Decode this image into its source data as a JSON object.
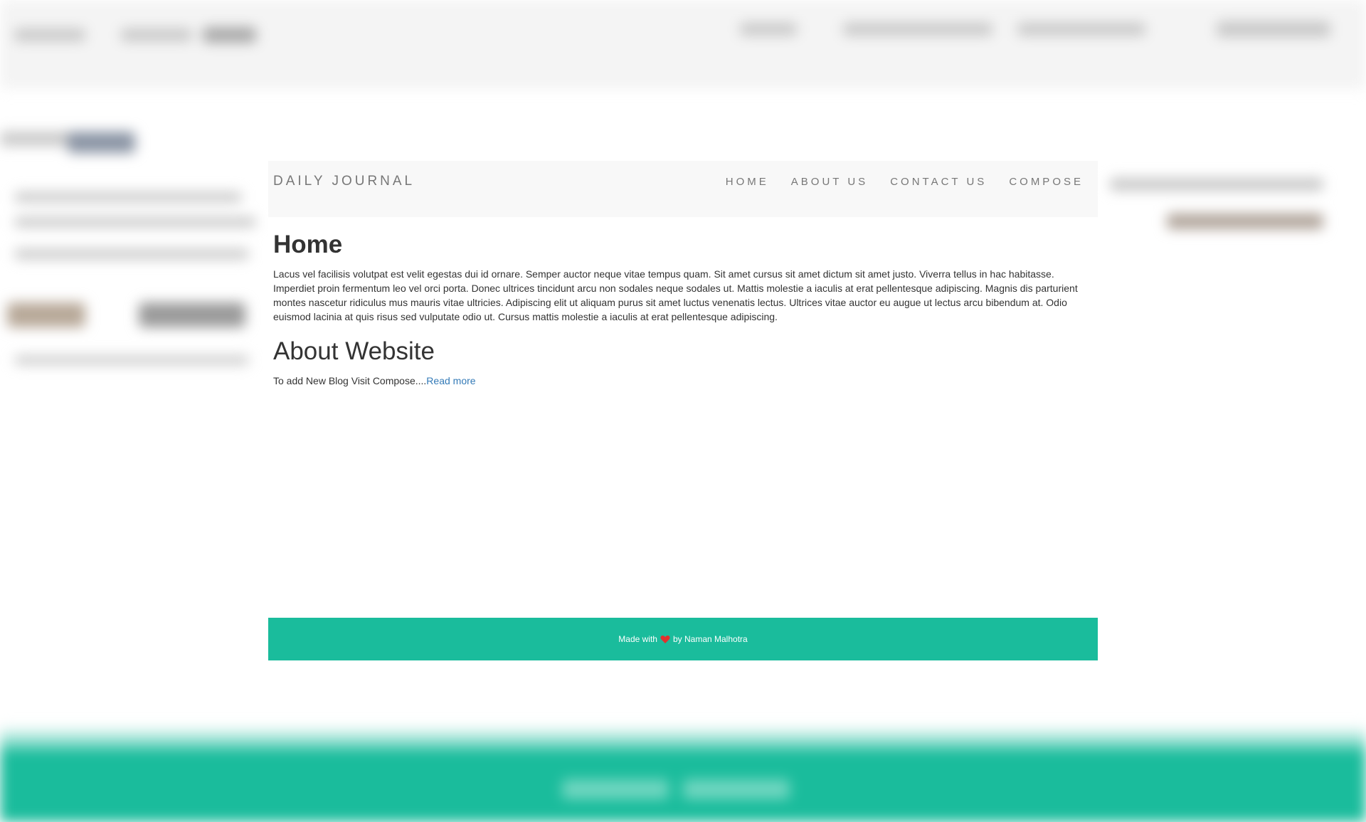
{
  "brand": "DAILY JOURNAL",
  "nav": {
    "items": [
      {
        "label": "HOME"
      },
      {
        "label": "ABOUT US"
      },
      {
        "label": "CONTACT US"
      },
      {
        "label": "COMPOSE"
      }
    ]
  },
  "home": {
    "title": "Home",
    "body": "Lacus vel facilisis volutpat est velit egestas dui id ornare. Semper auctor neque vitae tempus quam. Sit amet cursus sit amet dictum sit amet justo. Viverra tellus in hac habitasse. Imperdiet proin fermentum leo vel orci porta. Donec ultrices tincidunt arcu non sodales neque sodales ut. Mattis molestie a iaculis at erat pellentesque adipiscing. Magnis dis parturient montes nascetur ridiculus mus mauris vitae ultricies. Adipiscing elit ut aliquam purus sit amet luctus venenatis lectus. Ultrices vitae auctor eu augue ut lectus arcu bibendum at. Odio euismod lacinia at quis risus sed vulputate odio ut. Cursus mattis molestie a iaculis at erat pellentesque adipiscing."
  },
  "about": {
    "title": "About Website",
    "text": "To add New Blog Visit Compose....",
    "link": "Read more"
  },
  "footer": {
    "prefix": "Made with",
    "icon": "heart-icon",
    "suffix": "by Naman Malhotra"
  },
  "colors": {
    "footer_bg": "#1abc9c",
    "navbar_bg": "#f8f8f8",
    "link": "#337ab7",
    "heart": "#e0322e"
  }
}
